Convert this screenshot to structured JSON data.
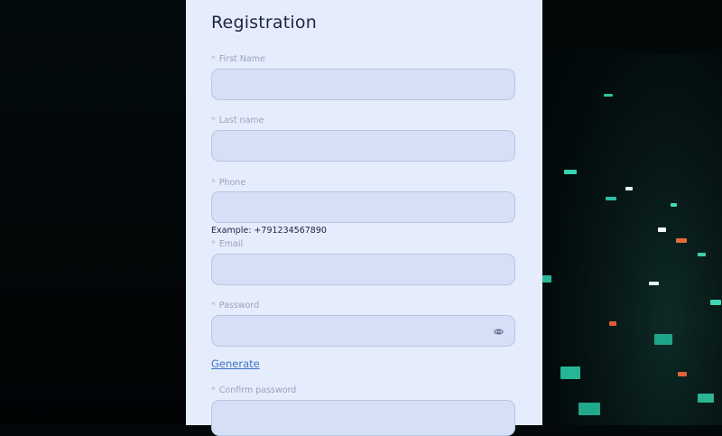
{
  "form": {
    "title": "Registration",
    "required_mark": "*",
    "fields": [
      {
        "label": "First Name",
        "value": ""
      },
      {
        "label": "Last name",
        "value": ""
      },
      {
        "label": "Phone",
        "value": "",
        "hint": "Example: +791234567890"
      },
      {
        "label": "Email",
        "value": ""
      },
      {
        "label": "Password",
        "value": "",
        "icon": "eye-icon"
      },
      {
        "label": "Confirm password",
        "value": ""
      }
    ],
    "generate_link": "Generate"
  },
  "colors": {
    "panel_bg": "#e5ecfb",
    "input_bg": "#d5e0f6",
    "title": "#1d2545",
    "link": "#3d74c9",
    "page_bg": "#03090a"
  }
}
